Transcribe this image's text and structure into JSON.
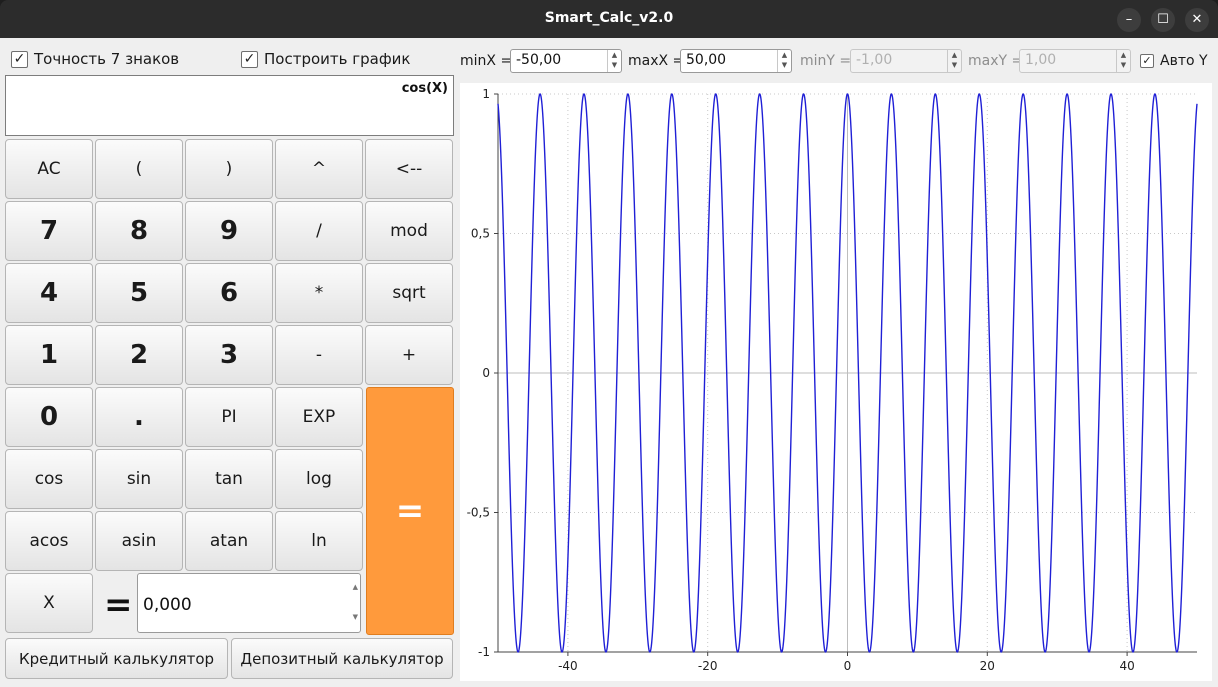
{
  "window": {
    "title": "Smart_Calc_v2.0",
    "minimize": "–",
    "maximize": "☐",
    "close": "✕"
  },
  "options": {
    "precision_label": "Точность 7 знаков",
    "plot_label": "Построить график",
    "auto_y_label": "Авто Y",
    "check_mark": "✓"
  },
  "ranges": {
    "minx_label": "minX =",
    "minx_value": "-50,00",
    "maxx_label": "maxX =",
    "maxx_value": "50,00",
    "miny_label": "minY =",
    "miny_value": "-1,00",
    "maxy_label": "maxY =",
    "maxy_value": "1,00"
  },
  "display": {
    "expression": "cos(X)"
  },
  "keypad": {
    "rows": [
      [
        "AC",
        "(",
        ")",
        "^",
        "<--"
      ],
      [
        "7",
        "8",
        "9",
        "/",
        "mod"
      ],
      [
        "4",
        "5",
        "6",
        "*",
        "sqrt"
      ],
      [
        "1",
        "2",
        "3",
        "-",
        "+"
      ],
      [
        "0",
        ".",
        "PI",
        "EXP"
      ],
      [
        "cos",
        "sin",
        "tan",
        "log"
      ],
      [
        "acos",
        "asin",
        "atan",
        "ln"
      ]
    ],
    "equals": "=",
    "x_button": "X",
    "x_equals": "=",
    "x_value": "0,000",
    "spin_up": "▲",
    "spin_down": "▼"
  },
  "bottom": {
    "credit": "Кредитный калькулятор",
    "deposit": "Депозитный калькулятор"
  },
  "chart_data": {
    "type": "line",
    "function": "cos(X)",
    "xlim": [
      -50,
      50
    ],
    "ylim": [
      -1,
      1
    ],
    "x_ticks": [
      "-40",
      "-20",
      "0",
      "20",
      "40"
    ],
    "x_tick_values": [
      -40,
      -20,
      0,
      20,
      40
    ],
    "y_ticks": [
      "1",
      "0,5",
      "0",
      "-0,5",
      "-1"
    ],
    "y_tick_values": [
      1,
      0.5,
      0,
      -0.5,
      -1
    ],
    "grid": true,
    "line_color": "#1f1fd6"
  }
}
